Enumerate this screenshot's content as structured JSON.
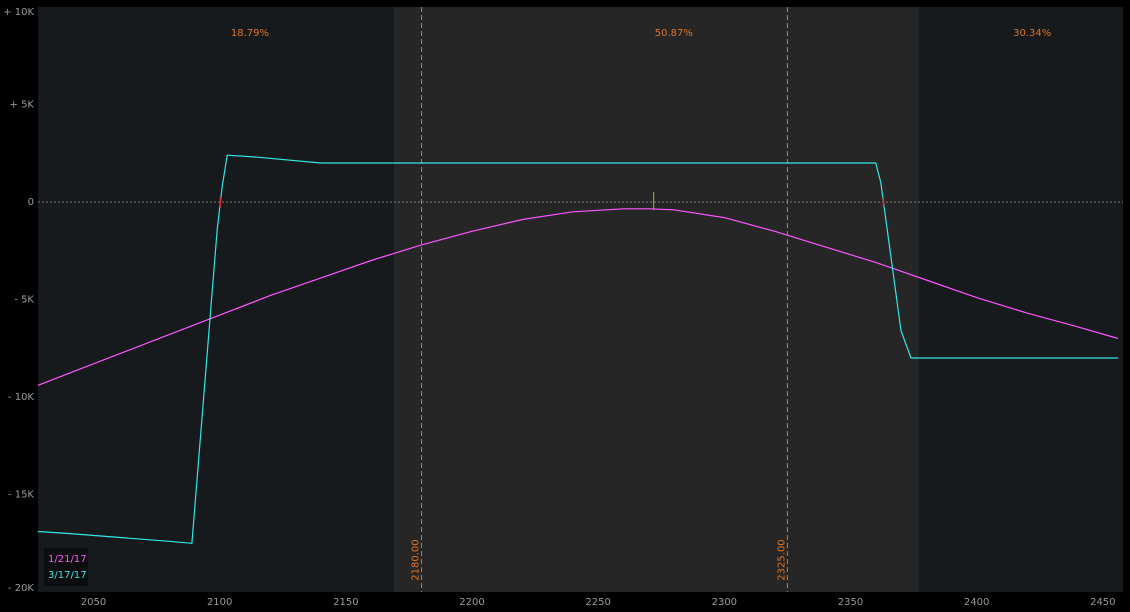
{
  "chart_data": {
    "type": "line",
    "xlim": [
      2028,
      2458
    ],
    "ylim": [
      -20000,
      10000
    ],
    "x_ticks": [
      2050,
      2100,
      2150,
      2200,
      2250,
      2300,
      2350,
      2400,
      2450
    ],
    "x_tick_labels": [
      "2050",
      "2100",
      "2150",
      "2200",
      "2250",
      "2300",
      "2350",
      "2400",
      "2450"
    ],
    "y_ticks": [
      10000,
      5000,
      0,
      -5000,
      -10000,
      -15000,
      -20000
    ],
    "y_tick_labels": [
      "+ 10K",
      "+ 5K",
      "0",
      "- 5K",
      "- 10K",
      "- 15K",
      "- 20K"
    ],
    "grid": false,
    "zero_line": true,
    "shaded_region": [
      2169,
      2377
    ],
    "vertical_markers": [
      {
        "x": 2180,
        "label": "2180.00"
      },
      {
        "x": 2325,
        "label": "2325.00"
      }
    ],
    "zone_labels": [
      {
        "x": 2112,
        "text": "18.79%"
      },
      {
        "x": 2280,
        "text": "50.87%"
      },
      {
        "x": 2422,
        "text": "30.34%"
      }
    ],
    "current_price": 2272,
    "legend_position": "bottom-left",
    "series": [
      {
        "name": "1/21/17",
        "color": "#ff55ff",
        "x": [
          2028,
          2040,
          2060,
          2080,
          2100,
          2120,
          2140,
          2160,
          2180,
          2200,
          2220,
          2240,
          2260,
          2270,
          2280,
          2300,
          2320,
          2340,
          2360,
          2380,
          2400,
          2420,
          2440,
          2456
        ],
        "y": [
          -9400,
          -8800,
          -7800,
          -6800,
          -5800,
          -4800,
          -3900,
          -3000,
          -2200,
          -1500,
          -900,
          -500,
          -350,
          -350,
          -400,
          -800,
          -1500,
          -2300,
          -3100,
          -4000,
          -4900,
          -5700,
          -6400,
          -7000
        ]
      },
      {
        "name": "3/17/17",
        "color": "#33e6e6",
        "x": [
          2028,
          2040,
          2060,
          2080,
          2089,
          2099,
          2101,
          2103,
          2115,
          2140,
          2200,
          2300,
          2360,
          2362,
          2370,
          2374,
          2456
        ],
        "y": [
          -16900,
          -17000,
          -17200,
          -17400,
          -17500,
          -1400,
          800,
          2400,
          2300,
          2000,
          2000,
          2000,
          2000,
          1000,
          -6600,
          -8000,
          -8000
        ]
      }
    ]
  }
}
